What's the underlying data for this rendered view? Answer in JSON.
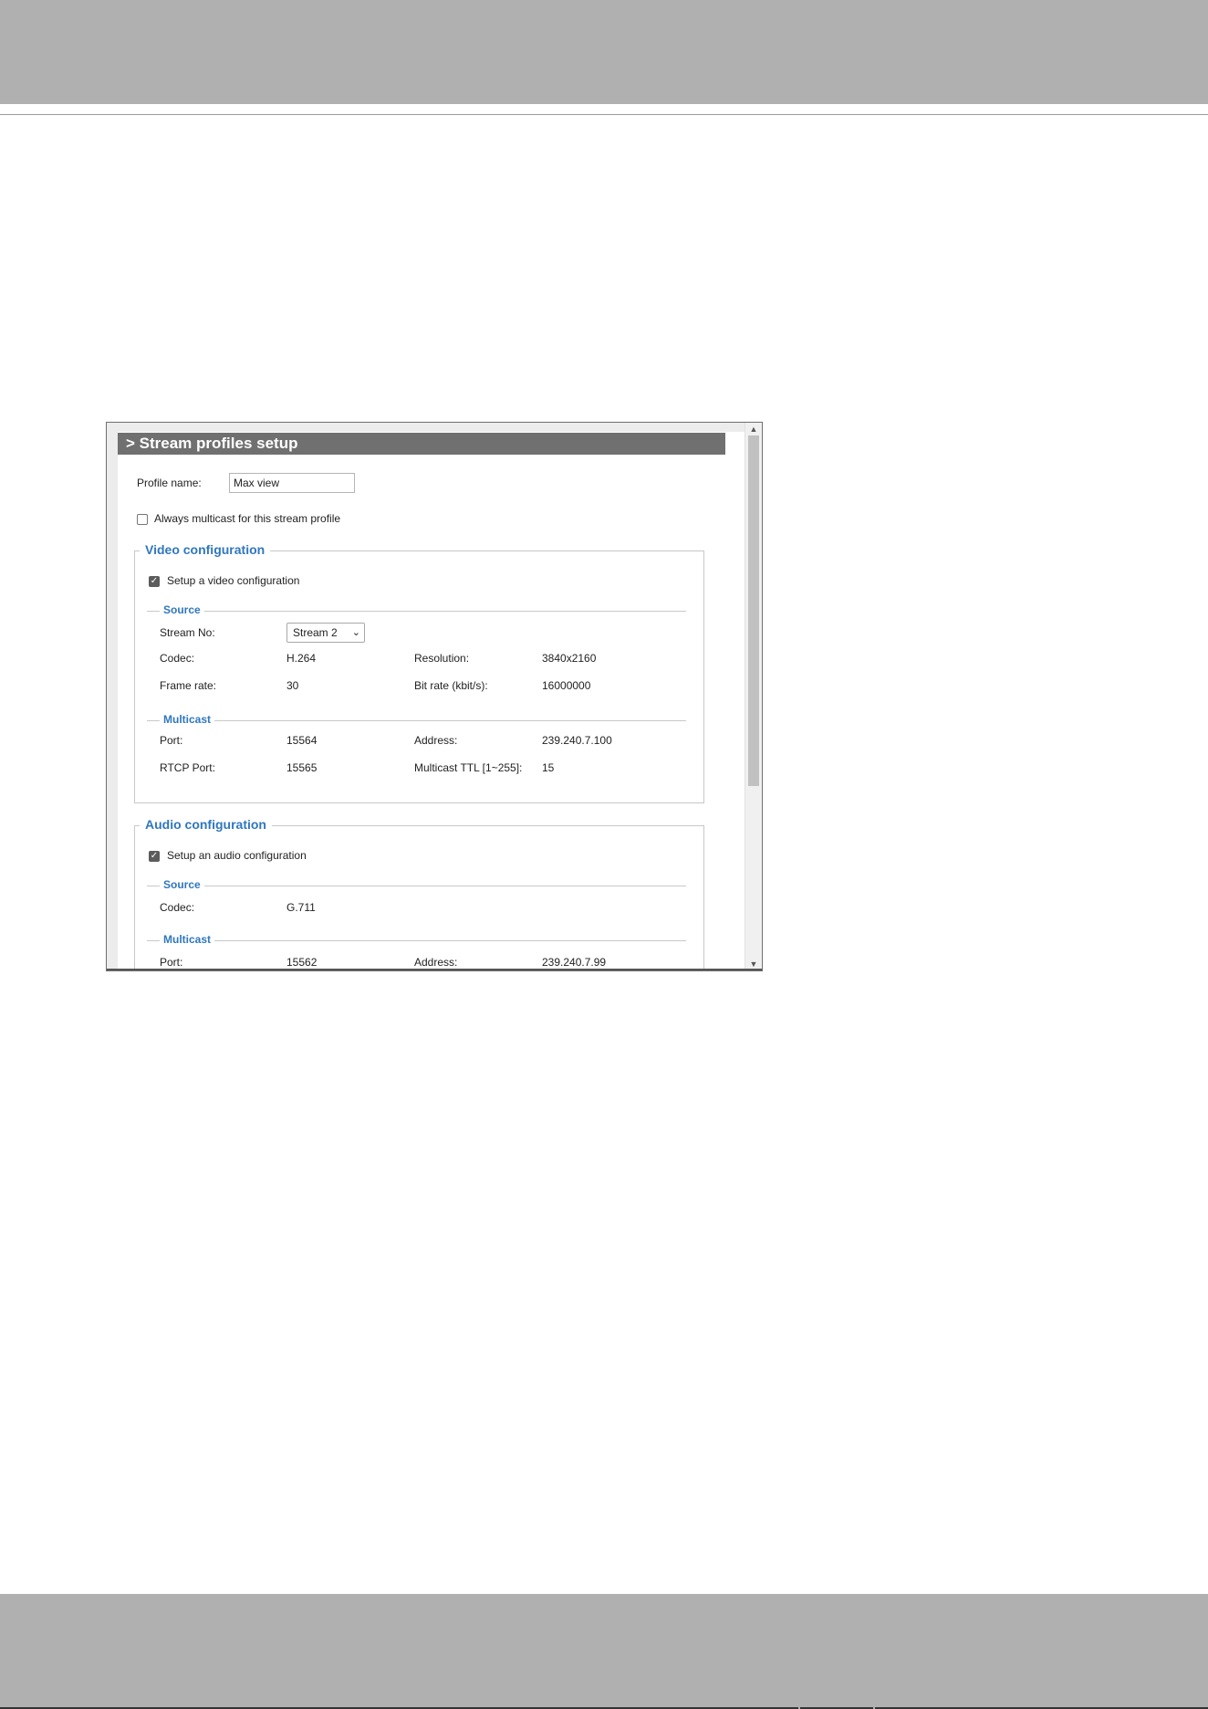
{
  "panel": {
    "title": "> Stream profiles setup",
    "profile_name_label": "Profile name:",
    "profile_name_value": "Max view",
    "always_multicast_label": "Always multicast for this stream profile",
    "always_multicast_checked": false
  },
  "video": {
    "legend": "Video configuration",
    "setup_label": "Setup a video configuration",
    "setup_checked": true,
    "source_heading": "Source",
    "stream_no_label": "Stream No:",
    "stream_no_value": "Stream 2",
    "codec_label": "Codec:",
    "codec_value": "H.264",
    "resolution_label": "Resolution:",
    "resolution_value": "3840x2160",
    "frame_rate_label": "Frame rate:",
    "frame_rate_value": "30",
    "bit_rate_label": "Bit rate (kbit/s):",
    "bit_rate_value": "16000000",
    "multicast_heading": "Multicast",
    "port_label": "Port:",
    "port_value": "15564",
    "address_label": "Address:",
    "address_value": "239.240.7.100",
    "rtcp_port_label": "RTCP Port:",
    "rtcp_port_value": "15565",
    "ttl_label": "Multicast TTL [1~255]:",
    "ttl_value": "15"
  },
  "audio": {
    "legend": "Audio configuration",
    "setup_label": "Setup an audio configuration",
    "setup_checked": true,
    "source_heading": "Source",
    "codec_label": "Codec:",
    "codec_value": "G.711",
    "multicast_heading": "Multicast",
    "port_label": "Port:",
    "port_value": "15562",
    "address_label": "Address:",
    "address_value": "239.240.7.99"
  },
  "icons": {
    "checkmark": "✓",
    "chevron_down": "⌄",
    "scroll_up": "▲",
    "scroll_down": "▼"
  }
}
